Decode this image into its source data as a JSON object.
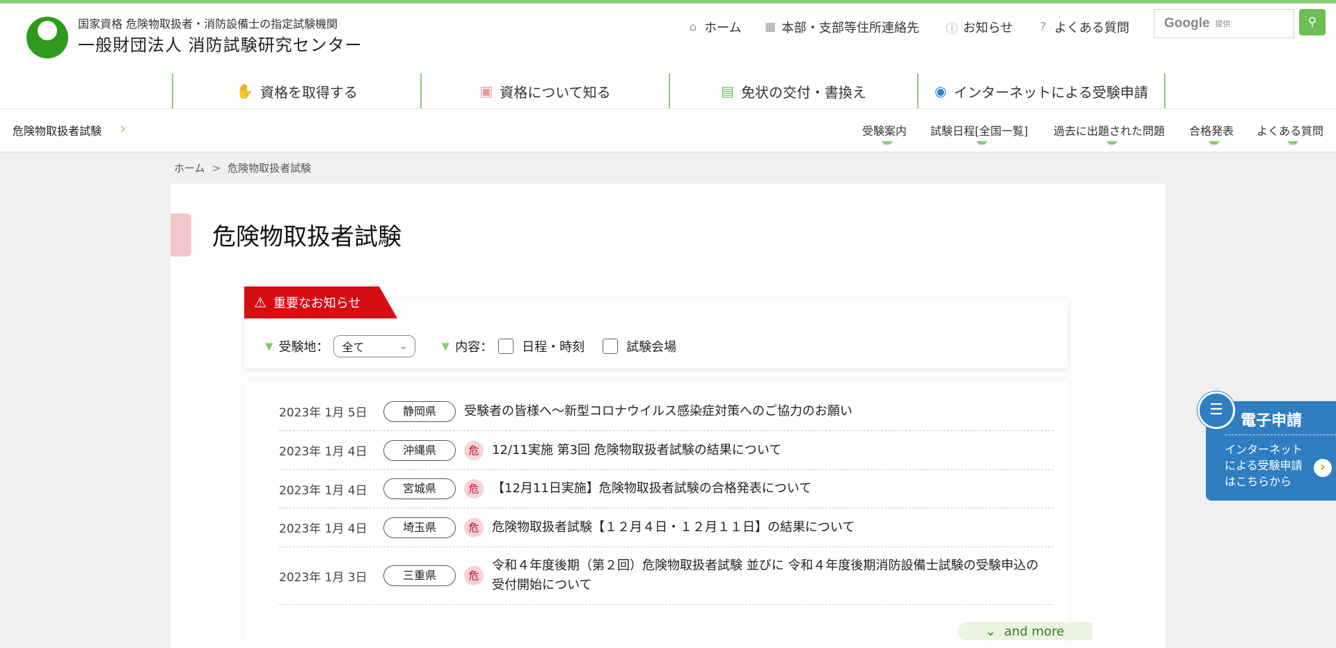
{
  "header": {
    "logo_sub": "国家資格 危険物取扱者・消防設備士の指定試験機関",
    "logo_main": "一般財団法人 消防試験研究センター",
    "utility_links": [
      {
        "label": "ホーム",
        "icon": "home-icon"
      },
      {
        "label": "本部・支部等住所連絡先",
        "icon": "map-icon"
      },
      {
        "label": "お知らせ",
        "icon": "info-icon"
      },
      {
        "label": "よくある質問",
        "icon": "question-icon"
      }
    ],
    "search": {
      "brand": "Google",
      "provided": "提供",
      "button_icon": "search-icon"
    }
  },
  "global_nav": [
    {
      "label": "資格を取得する",
      "icon": "hand-icon"
    },
    {
      "label": "資格について知る",
      "icon": "book-icon"
    },
    {
      "label": "免状の交付・書換え",
      "icon": "id-card-icon"
    },
    {
      "label": "インターネットによる受験申請",
      "icon": "document-icon"
    }
  ],
  "sub_nav": {
    "title": "危険物取扱者試験",
    "links": [
      "受験案内",
      "試験日程[全国一覧]",
      "過去に出題された問題",
      "合格発表",
      "よくある質問"
    ]
  },
  "breadcrumb": {
    "home": "ホーム",
    "sep": ">",
    "current": "危険物取扱者試験"
  },
  "page_title": "危険物取扱者試験",
  "notice": {
    "tab_label": "重要なお知らせ",
    "filter_place_label": "受験地：",
    "filter_place_value": "全て",
    "filter_content_label": "内容：",
    "checkbox_1": "日程・時刻",
    "checkbox_2": "試験会場",
    "items": [
      {
        "date": "2023年 1月 5日",
        "pref": "静岡県",
        "badge": "",
        "title": "受験者の皆様へ～新型コロナウイルス感染症対策へのご協力のお願い"
      },
      {
        "date": "2023年 1月 4日",
        "pref": "沖縄県",
        "badge": "危",
        "title": "12/11実施 第3回 危険物取扱者試験の結果について"
      },
      {
        "date": "2023年 1月 4日",
        "pref": "宮城県",
        "badge": "危",
        "title": "【12月11日実施】危険物取扱者試験の合格発表について"
      },
      {
        "date": "2023年 1月 4日",
        "pref": "埼玉県",
        "badge": "危",
        "title": "危険物取扱者試験【１２月４日・１２月１１日】の結果について"
      },
      {
        "date": "2023年 1月 3日",
        "pref": "三重県",
        "badge": "危",
        "title": "令和４年度後期（第２回）危険物取扱者試験 並びに 令和４年度後期消防設備士試験の受験申込の受付開始について"
      }
    ],
    "more_label": "and more"
  },
  "side_button": {
    "title": "電子申請",
    "desc_1": "インターネット",
    "desc_2": "による受験申請",
    "desc_3": "はこちらから"
  },
  "colors": {
    "accent_green": "#8dc97a",
    "brand_green": "#2f9a1e",
    "alert_red": "#d40e12",
    "side_blue": "#2f7ec1"
  }
}
